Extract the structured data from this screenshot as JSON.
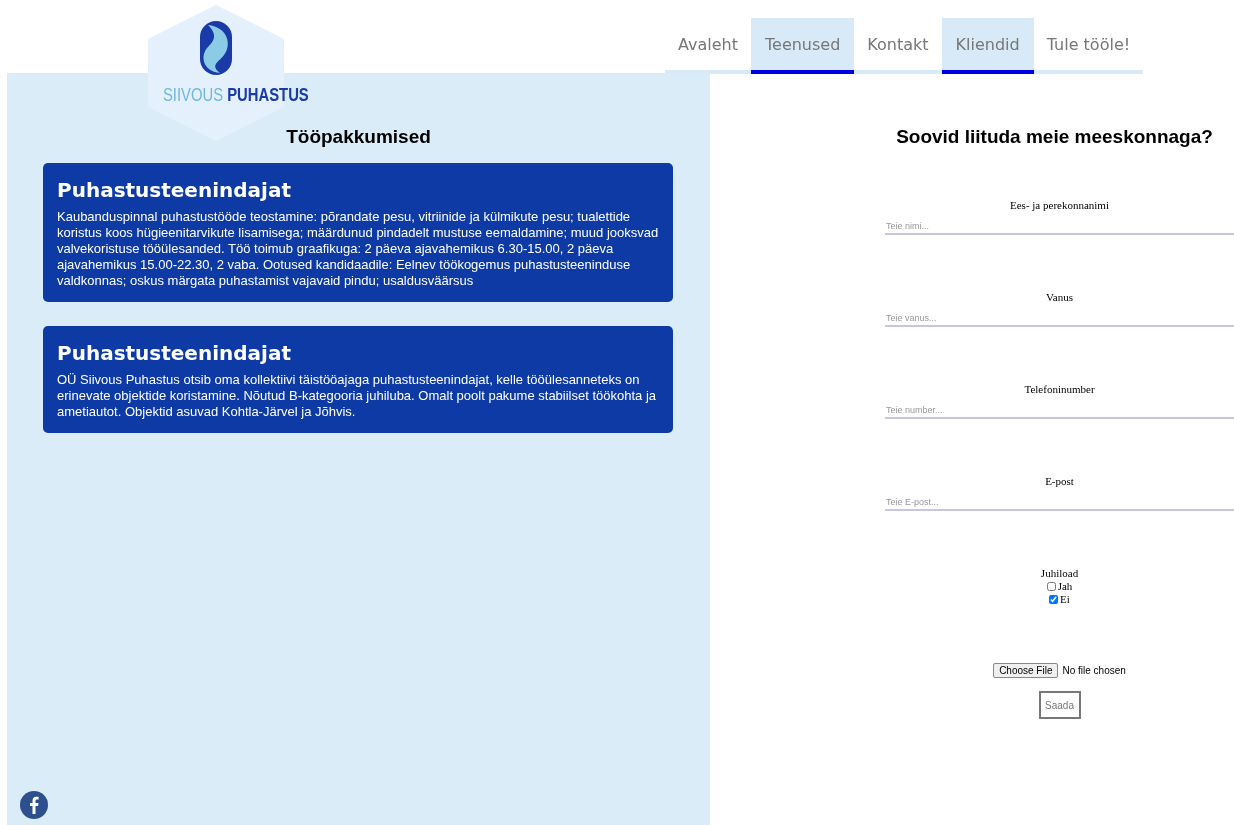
{
  "logo": {
    "word_1": "SIIVOUS",
    "word_2": "PUHASTUS"
  },
  "nav": [
    {
      "label": "Avaleht",
      "selected": false
    },
    {
      "label": "Teenused",
      "selected": true
    },
    {
      "label": "Kontakt",
      "selected": false
    },
    {
      "label": "Kliendid",
      "selected": true
    },
    {
      "label": "Tule tööle!",
      "selected": false
    }
  ],
  "jobs": {
    "title": "Tööpakkumised",
    "cards": [
      {
        "title": "Puhastusteenindajat",
        "text": "Kaubanduspinnal puhastustööde teostamine: põrandate pesu, vitriinide ja külmikute pesu; tualettide koristus koos hügieenitarvikute lisamisega; määrdunud pindadelt mustuse eemaldamine; muud jooksvad valvekoristuse tööülesanded. Töö toimub graafikuga: 2 päeva ajavahemikus 6.30-15.00, 2 päeva ajavahemikus 15.00-22.30, 2 vaba. Ootused kandidaadile: Eelnev töökogemus puhastusteeninduse valdkonnas; oskus märgata puhastamist vajavaid pindu; usaldusväärsus"
      },
      {
        "title": "Puhastusteenindajat",
        "text": "OÜ Siivous Puhastus otsib oma kollektiivi täistööajaga puhastusteenindajat, kelle tööülesanneteks on erinevate objektide koristamine. Nõutud B-kategooria juhiluba. Omalt poolt pakume stabiilset töökohta ja ametiautot. Objektid asuvad Kohtla-Järvel ja Jõhvis."
      }
    ]
  },
  "form": {
    "title": "Soovid liituda meie meeskonnaga?",
    "fields": [
      {
        "label": "Ees- ja perekonnanimi",
        "placeholder": "Teie nimi..."
      },
      {
        "label": "Vanus",
        "placeholder": "Teie vanus..."
      },
      {
        "label": "Telefoninumber",
        "placeholder": "Teie number..."
      },
      {
        "label": "E-post",
        "placeholder": "Teie E-post..."
      }
    ],
    "license": {
      "label": "Juhiload",
      "options": [
        {
          "label": "Jah",
          "checked": false
        },
        {
          "label": "Ei",
          "checked": true
        }
      ]
    },
    "file": {
      "button": "Choose File",
      "status": "No file chosen"
    },
    "submit": "Saada"
  }
}
